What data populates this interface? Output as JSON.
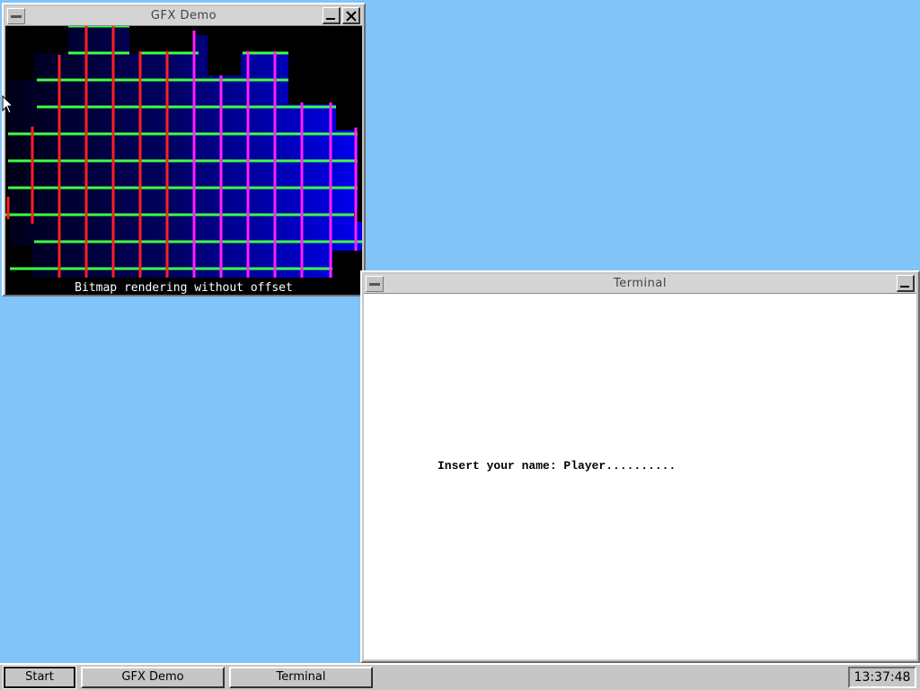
{
  "colors": {
    "desktop": "#80c4fa",
    "window_face": "#c6c6c6",
    "gfx_background": "#000000",
    "gfx_fill": "#0000e0",
    "grid_green": "#40ff40",
    "grid_red": "#ff2020",
    "grid_magenta": "#ff20ff"
  },
  "gfx_window": {
    "title": "GFX Demo",
    "caption": "Bitmap rendering without offset",
    "buttons": {
      "system_menu_icon": "minus-icon",
      "minimize_icon": "minimize-icon",
      "close_icon": "close-icon"
    }
  },
  "terminal_window": {
    "title": "Terminal",
    "prompt_line": "Insert your name: Player.........."
  },
  "taskbar": {
    "start_label": "Start",
    "items": [
      "GFX Demo",
      "Terminal"
    ],
    "clock": "13:37:48"
  }
}
